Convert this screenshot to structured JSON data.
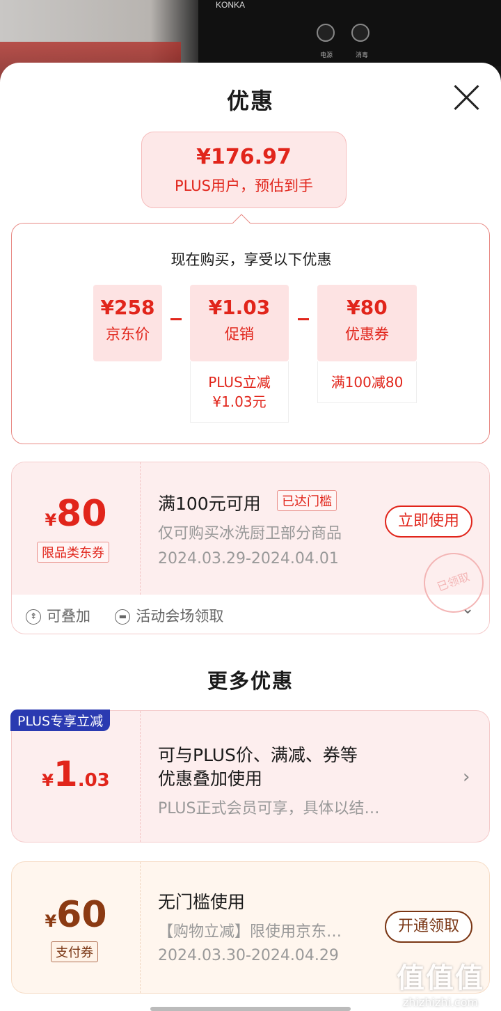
{
  "background": {
    "brand": "KONKA",
    "knob_labels": [
      "电源",
      "消毒"
    ]
  },
  "sheet": {
    "title": "优惠",
    "close_icon": "close-icon"
  },
  "estimate": {
    "price": "¥176.97",
    "label": "PLUS用户，预估到手"
  },
  "calc": {
    "heading": "现在购买，享受以下优惠",
    "items": [
      {
        "value": "¥258",
        "label": "京东价"
      },
      {
        "value": "¥1.03",
        "label": "促销",
        "note_line1": "PLUS立减",
        "note_line2": "¥1.03元"
      },
      {
        "value": "¥80",
        "label": "优惠券",
        "note_line1": "满100减80"
      }
    ],
    "operator": "−"
  },
  "coupon": {
    "currency": "¥",
    "amount": "80",
    "type_tag": "限品类东券",
    "title": "满100元可用",
    "status_tag": "已达门槛",
    "scope": "仅可购买冰洗厨卫部分商品",
    "validity": "2024.03.29-2024.04.01",
    "action": "立即使用",
    "stamp": "已领取",
    "footer_stack": "可叠加",
    "footer_source": "活动会场领取"
  },
  "more": {
    "title": "更多优惠"
  },
  "plus_offer": {
    "ribbon": "PLUS专享立减",
    "currency": "¥",
    "amount_int": "1",
    "amount_dec": ".03",
    "line1": "可与PLUS价、满减、券等",
    "line2": "优惠叠加使用",
    "desc": "PLUS正式会员可享，具体以结…"
  },
  "pay_coupon": {
    "currency": "¥",
    "amount": "60",
    "type_tag": "支付券",
    "title": "无门槛使用",
    "desc": "【购物立减】限使用京东…",
    "validity": "2024.03.30-2024.04.29",
    "action": "开通领取"
  },
  "watermark": {
    "big": "值值值",
    "small": "zhizhizhi.com"
  },
  "colors": {
    "accent": "#e1251b",
    "plus_blue": "#2a3ab1",
    "pay_brown": "#7a3614"
  }
}
